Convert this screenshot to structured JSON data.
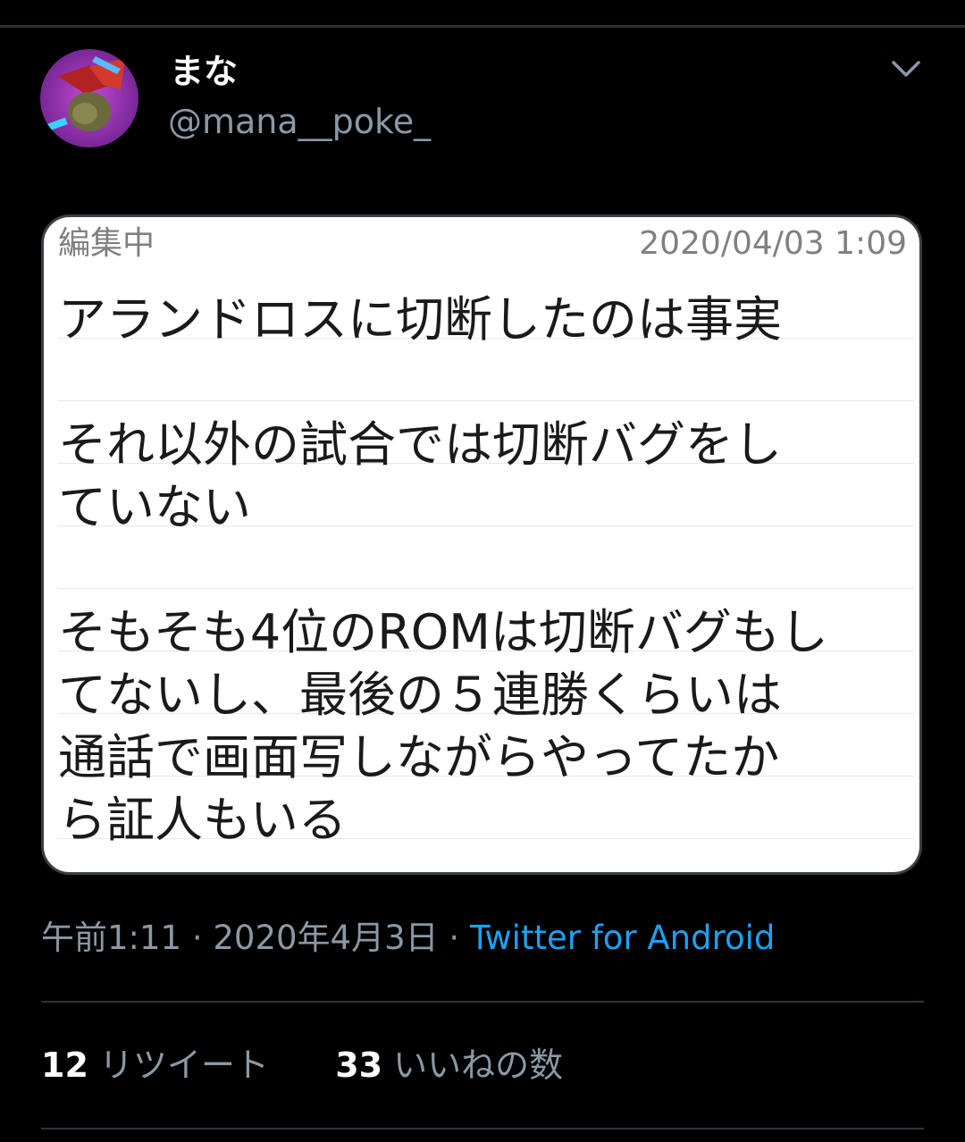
{
  "user": {
    "display_name": "まな",
    "handle": "@mana__poke_",
    "avatar_icon": "avatar-image"
  },
  "menu": {
    "icon": "chevron-down-icon"
  },
  "note": {
    "status": "編集中",
    "date": "2020/04/03 1:09",
    "lines": [
      "アランドロスに切断したのは事実",
      "",
      "それ以外の試合では切断バグをし",
      "ていない",
      "",
      "そもそも4位のROMは切断バグもし",
      "てないし、最後の５連勝くらいは",
      "通話で画面写しながらやってたか",
      "ら証人もいる"
    ]
  },
  "meta": {
    "time": "午前1:11",
    "sep1": "·",
    "date": "2020年4月3日",
    "sep2": "·",
    "source": "Twitter for Android"
  },
  "stats": {
    "retweets_count": "12",
    "retweets_label": "リツイート",
    "likes_count": "33",
    "likes_label": "いいねの数"
  },
  "colors": {
    "background": "#000000",
    "secondary_text": "#8b98a5",
    "link": "#1da1f2",
    "card_bg": "#ffffff"
  }
}
